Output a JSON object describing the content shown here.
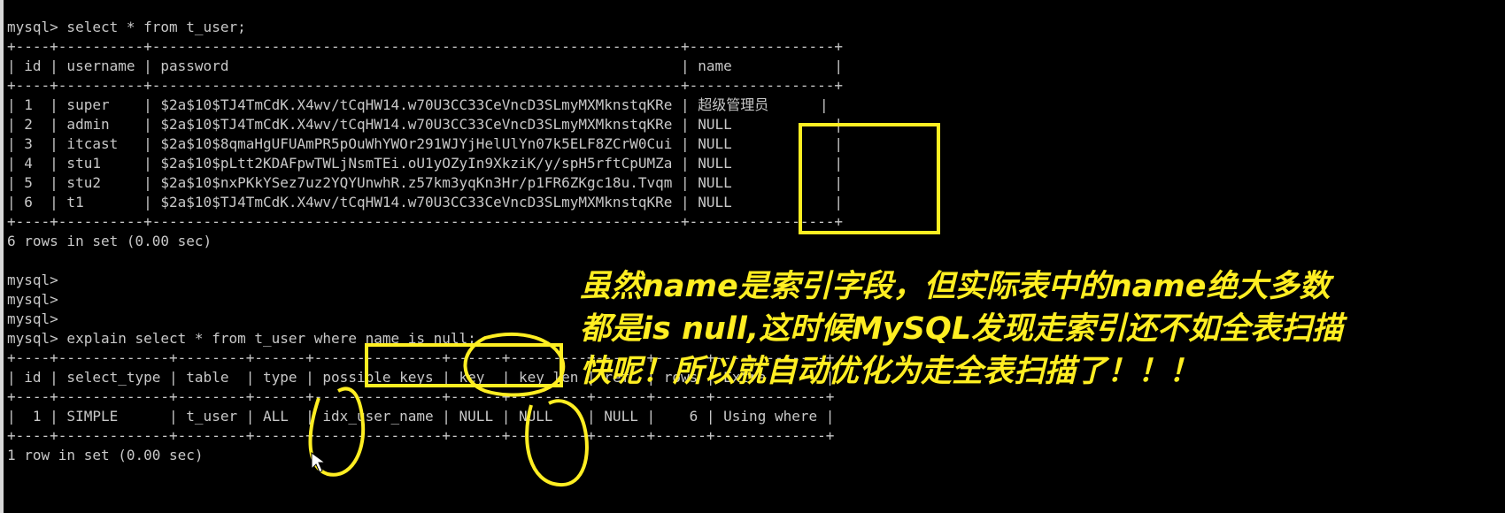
{
  "terminal": {
    "lines": [
      "mysql> select * from t_user;",
      "+----+----------+--------------------------------------------------------------+-----------------+",
      "| id | username | password                                                     | name            |",
      "+----+----------+--------------------------------------------------------------+-----------------+",
      "| 1  | super    | $2a$10$TJ4TmCdK.X4wv/tCqHW14.w70U3CC33CeVncD3SLmyMXMknstqKRe | 超级管理员      |",
      "| 2  | admin    | $2a$10$TJ4TmCdK.X4wv/tCqHW14.w70U3CC33CeVncD3SLmyMXMknstqKRe | NULL            |",
      "| 3  | itcast   | $2a$10$8qmaHgUFUAmPR5pOuWhYWOr291WJYjHelUlYn07k5ELF8ZCrW0Cui | NULL            |",
      "| 4  | stu1     | $2a$10$pLtt2KDAFpwTWLjNsmTEi.oU1yOZyIn9XkziK/y/spH5rftCpUMZa | NULL            |",
      "| 5  | stu2     | $2a$10$nxPKkYSez7uz2YQYUnwhR.z57km3yqKn3Hr/p1FR6ZKgc18u.Tvqm | NULL            |",
      "| 6  | t1       | $2a$10$TJ4TmCdK.X4wv/tCqHW14.w70U3CC33CeVncD3SLmyMXMknstqKRe | NULL            |",
      "+----+----------+--------------------------------------------------------------+-----------------+",
      "6 rows in set (0.00 sec)",
      "",
      "mysql>",
      "mysql>",
      "mysql>",
      "mysql> explain select * from t_user where name is null;",
      "+----+-------------+--------+------+---------------+------+---------+------+------+-------------+",
      "| id | select_type | table  | type | possible_keys | key  | key_len | ref  | rows | Extra       |",
      "+----+-------------+--------+------+---------------+------+---------+------+------+-------------+",
      "|  1 | SIMPLE      | t_user | ALL  | idx_user_name | NULL | NULL    | NULL |    6 | Using where |",
      "+----+-------------+--------+------+---------------+------+---------+------+------+-------------+",
      "1 row in set (0.00 sec)"
    ]
  },
  "annotation": {
    "line1": "虽然name是索引字段，但实际表中的name绝大多数",
    "line2": "都是is null,这时候MySQL发现走索引还不如全表扫描",
    "line3": "快呢！所以就自动优化为走全表扫描了！！！"
  },
  "colors": {
    "background": "#000000",
    "terminal_text": "#c8c8c8",
    "highlight": "#ffee22"
  }
}
